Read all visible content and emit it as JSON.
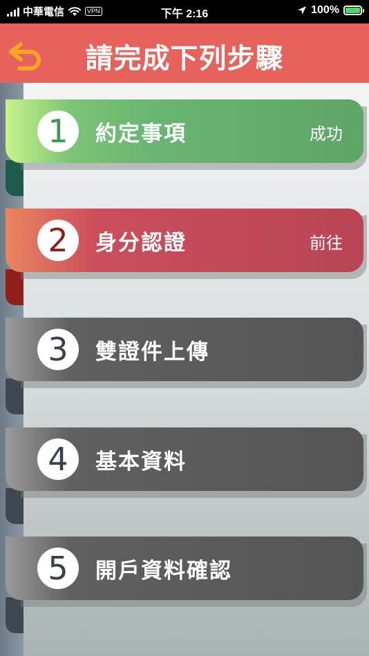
{
  "status_bar": {
    "carrier": "中華電信",
    "vpn": "VPN",
    "time": "下午 2:16",
    "battery": "100%"
  },
  "header": {
    "title": "請完成下列步驟",
    "back_icon": "back-arrow-icon"
  },
  "steps": [
    {
      "number": "1",
      "label": "約定事項",
      "status": "成功"
    },
    {
      "number": "2",
      "label": "身分認證",
      "status": "前往"
    },
    {
      "number": "3",
      "label": "雙證件上傳",
      "status": ""
    },
    {
      "number": "4",
      "label": "基本資料",
      "status": ""
    },
    {
      "number": "5",
      "label": "開戶資料確認",
      "status": ""
    }
  ],
  "colors": {
    "header": "#e7625a",
    "back_icon": "#f5a623",
    "step_done": "#5fa566",
    "step_active": "#b84554",
    "step_pending": "#555555"
  }
}
